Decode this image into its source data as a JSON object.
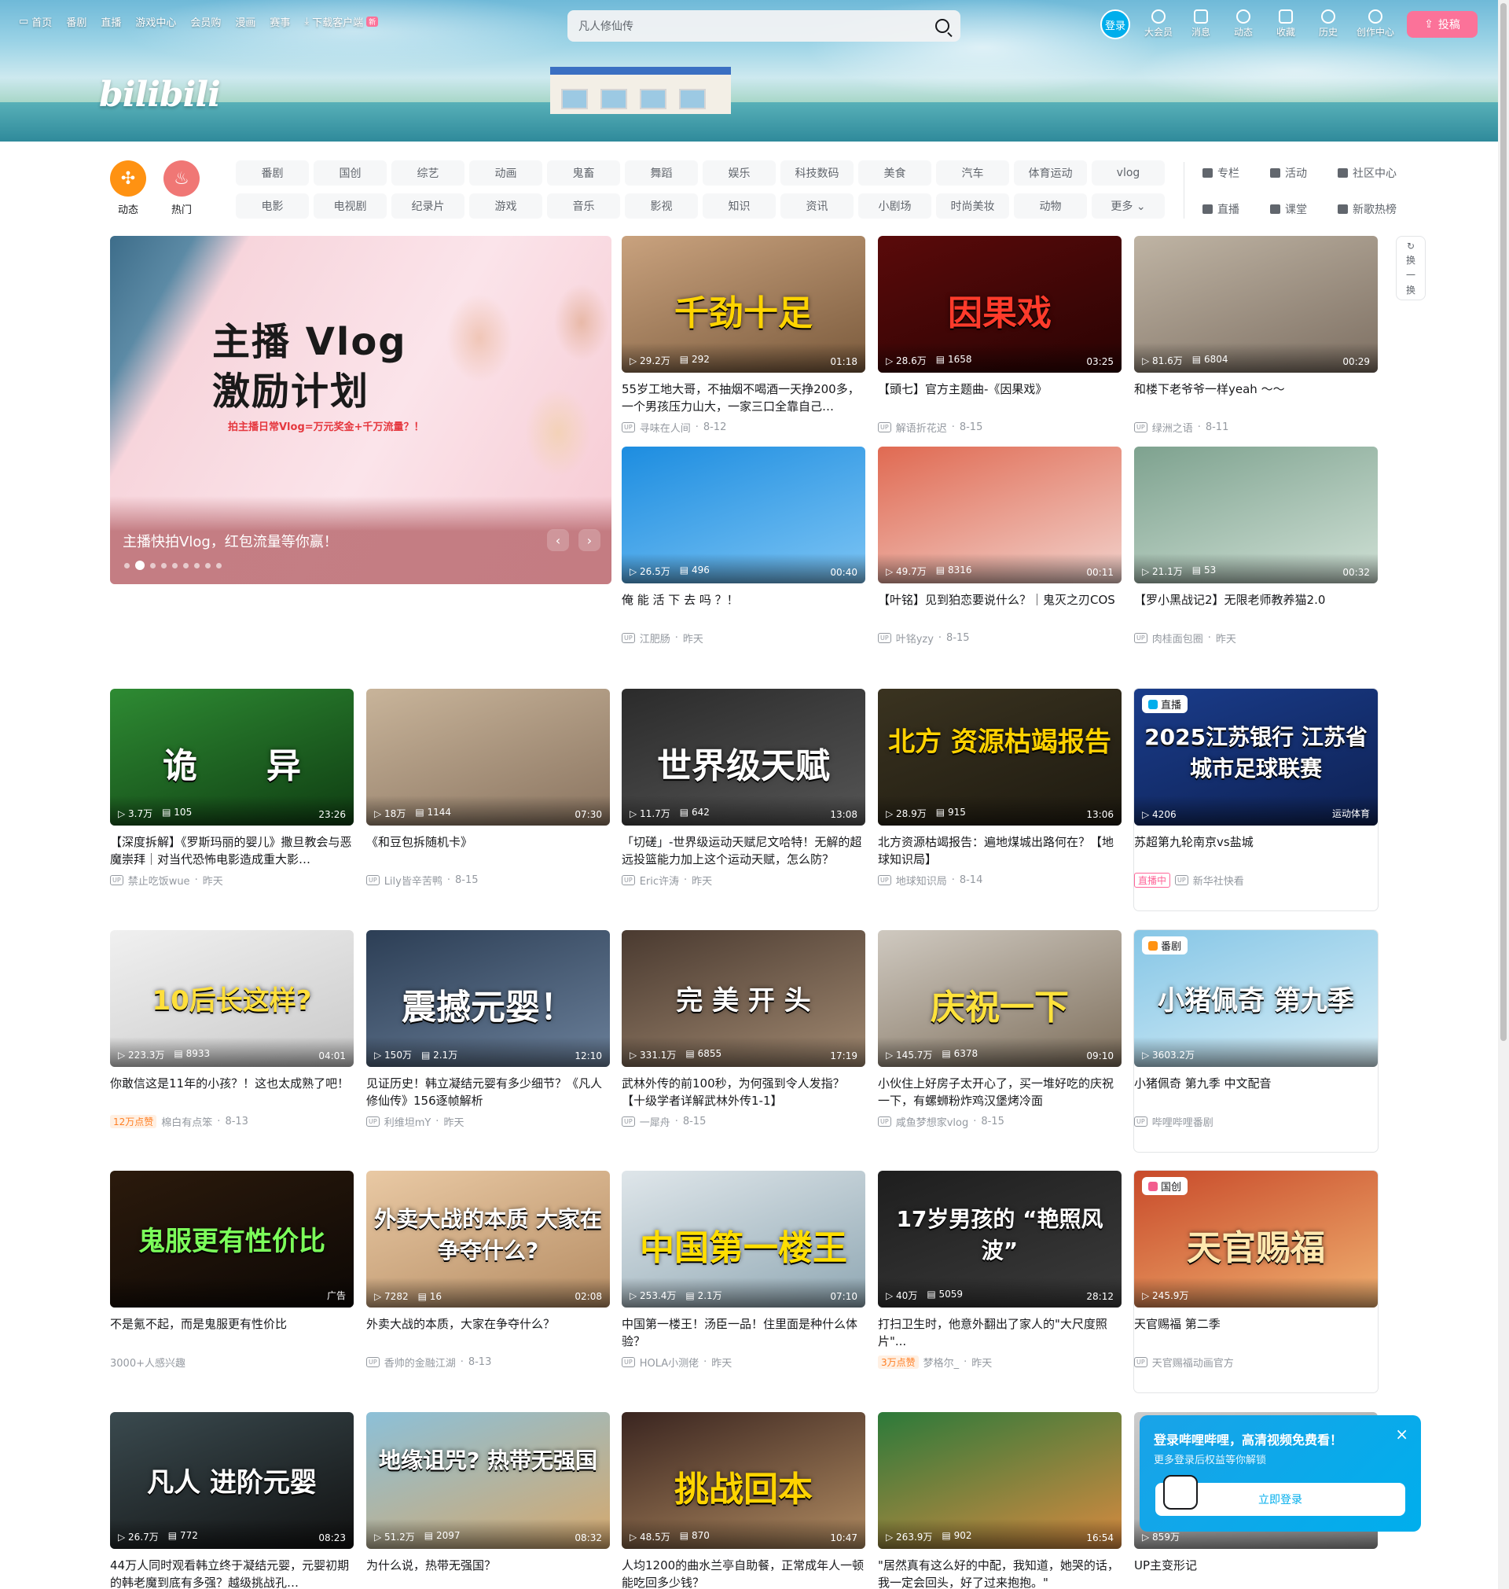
{
  "topnav": [
    "首页",
    "番剧",
    "直播",
    "游戏中心",
    "会员购",
    "漫画",
    "赛事",
    "下载客户端"
  ],
  "newtag": "新",
  "search": {
    "value": "凡人修仙传"
  },
  "logo": "bilibili",
  "rightnav": {
    "login": "登录",
    "items": [
      "大会员",
      "消息",
      "动态",
      "收藏",
      "历史",
      "创作中心"
    ],
    "upload": "投稿"
  },
  "channels": {
    "dynamic": "动态",
    "hot": "热门",
    "row1": [
      "番剧",
      "国创",
      "综艺",
      "动画",
      "鬼畜",
      "舞蹈",
      "娱乐",
      "科技数码",
      "美食",
      "汽车",
      "体育运动",
      "vlog"
    ],
    "row2": [
      "电影",
      "电视剧",
      "纪录片",
      "游戏",
      "音乐",
      "影视",
      "知识",
      "资讯",
      "小剧场",
      "时尚美妆",
      "动物",
      "更多"
    ],
    "right": [
      "专栏",
      "活动",
      "社区中心",
      "直播",
      "课堂",
      "新歌热榜"
    ]
  },
  "banner": {
    "line1": "主播 Vlog",
    "line2": "激励计划",
    "line3": "拍主播日常Vlog=万元奖金+千万流量？！",
    "caption": "主播快拍Vlog，红包流量等你赢！"
  },
  "refresh": [
    "换",
    "一",
    "换"
  ],
  "cards": [
    {
      "views": "29.2万",
      "danmu": "292",
      "dur": "01:18",
      "title": "55岁工地大哥，不抽烟不喝酒一天挣200多，一个男孩压力山大，一家三口全靠自己…",
      "up": "寻味在人间",
      "date": "8-12",
      "big": "千劲十足"
    },
    {
      "views": "28.6万",
      "danmu": "1658",
      "dur": "03:25",
      "title": "【頭七】官方主题曲-《因果戏》",
      "up": "解语折花迟",
      "date": "8-15",
      "big": "因果戏"
    },
    {
      "views": "81.6万",
      "danmu": "6804",
      "dur": "00:29",
      "title": "和楼下老爷爷一样yeah ～～",
      "up": "绿洲之语",
      "date": "8-11",
      "big": ""
    },
    {
      "views": "26.5万",
      "danmu": "496",
      "dur": "00:40",
      "title": "俺 能 活 下 去 吗 ？！",
      "up": "江肥肠",
      "date": "昨天",
      "big": ""
    },
    {
      "views": "49.7万",
      "danmu": "8316",
      "dur": "00:11",
      "title": "【叶铭】见到狛恋要说什么？｜鬼灭之刃COS",
      "up": "叶铭yzy",
      "date": "8-15",
      "big": ""
    },
    {
      "views": "21.1万",
      "danmu": "53",
      "dur": "00:32",
      "title": "【罗小黑战记2】无限老师教养猫2.0",
      "up": "肉桂面包圈",
      "date": "昨天",
      "big": ""
    },
    {
      "views": "3.7万",
      "danmu": "105",
      "dur": "23:26",
      "title": "【深度拆解】《罗斯玛丽的婴儿》撒旦教会与恶魔崇拜｜对当代恐怖电影造成重大影…",
      "up": "禁止吃饭wue",
      "date": "昨天",
      "big": "诡　　异"
    },
    {
      "views": "18万",
      "danmu": "1144",
      "dur": "07:30",
      "title": "《和豆包拆随机卡》",
      "up": "Lily皆辛苦鸭",
      "date": "8-15",
      "big": ""
    },
    {
      "views": "11.7万",
      "danmu": "642",
      "dur": "13:08",
      "title": "「切磋」-世界级运动天赋尼文哈特！无解的超远投篮能力加上这个运动天赋，怎么防？",
      "up": "Eric许涛",
      "date": "昨天",
      "big": "世界级天赋"
    },
    {
      "views": "28.9万",
      "danmu": "915",
      "dur": "13:06",
      "title": "北方资源枯竭报告：遍地煤城出路何在？【地球知识局】",
      "up": "地球知识局",
      "date": "8-14",
      "big": "北方 资源枯竭报告"
    },
    {
      "views": "4206",
      "danmu": "",
      "dur": "运动体育",
      "title": "苏超第九轮南京vs盐城",
      "up": "新华社快看",
      "date": "",
      "big": "2025江苏银行 江苏省城市足球联赛",
      "tag": "直播",
      "live": "直播中"
    },
    {
      "views": "223.3万",
      "danmu": "8933",
      "dur": "04:01",
      "title": "你敢信这是11年的小孩？！这也太成熟了吧！",
      "up": "棉白有点笨",
      "date": "8-13",
      "big": "10后长这样?",
      "hot": "12万点赞"
    },
    {
      "views": "150万",
      "danmu": "2.1万",
      "dur": "12:10",
      "title": "见证历史！韩立凝结元婴有多少细节？《凡人修仙传》156逐帧解析",
      "up": "利维坦mY",
      "date": "昨天",
      "big": "震撼元婴！"
    },
    {
      "views": "331.1万",
      "danmu": "6855",
      "dur": "17:19",
      "title": "武林外传的前100秒，为何强到令人发指？【十级学者详解武林外传1-1】",
      "up": "一犀舟",
      "date": "8-15",
      "big": "完 美 开 头"
    },
    {
      "views": "145.7万",
      "danmu": "6378",
      "dur": "09:10",
      "title": "小伙住上好房子太开心了，买一堆好吃的庆祝一下，有螺蛳粉炸鸡汉堡烤冷面",
      "up": "咸鱼梦想家vlog",
      "date": "8-15",
      "big": "庆祝一下"
    },
    {
      "views": "3603.2万",
      "danmu": "",
      "dur": "",
      "title": "小猪佩奇 第九季 中文配音",
      "up": "哔哩哔哩番剧",
      "date": "",
      "big": "小猪佩奇 第九季",
      "tag": "番剧"
    },
    {
      "views": "",
      "danmu": "",
      "dur": "广告",
      "title": "不是氪不起，而是鬼服更有性价比",
      "up": "3000+人感兴趣",
      "date": "",
      "big": "鬼服更有性价比"
    },
    {
      "views": "7282",
      "danmu": "16",
      "dur": "02:08",
      "title": "外卖大战的本质，大家在争夺什么？",
      "up": "香帅的金融江湖",
      "date": "8-13",
      "big": "外卖大战的本质 大家在争夺什么?"
    },
    {
      "views": "253.4万",
      "danmu": "2.1万",
      "dur": "07:10",
      "title": "中国第一楼王！汤臣一品！住里面是种什么体验？",
      "up": "HOLA小测佬",
      "date": "昨天",
      "big": "中国第一楼王"
    },
    {
      "views": "40万",
      "danmu": "5059",
      "dur": "28:12",
      "title": "打扫卫生时，他意外翻出了家人的\"大尺度照片\"...",
      "up": "梦格尔_",
      "date": "昨天",
      "big": "17岁男孩的 “艳照风波”",
      "hot": "3万点赞"
    },
    {
      "views": "245.9万",
      "danmu": "",
      "dur": "",
      "title": "天官赐福 第二季",
      "up": "天官赐福动画官方",
      "date": "",
      "big": "天官赐福",
      "tag": "国创"
    },
    {
      "views": "26.7万",
      "danmu": "772",
      "dur": "08:23",
      "title": "44万人同时观看韩立终于凝结元婴，元婴初期的韩老魔到底有多强？越级挑战孔…",
      "up": "",
      "date": "",
      "big": "凡人 进阶元婴"
    },
    {
      "views": "51.2万",
      "danmu": "2097",
      "dur": "08:32",
      "title": "为什么说，热带无强国？",
      "up": "",
      "date": "",
      "big": "地缘诅咒? 热带无强国"
    },
    {
      "views": "48.5万",
      "danmu": "870",
      "dur": "10:47",
      "title": "人均1200的曲水兰亭自助餐，正常成年人一顿能吃回多少钱？",
      "up": "",
      "date": "",
      "big": "挑战回本"
    },
    {
      "views": "263.9万",
      "danmu": "902",
      "dur": "16:54",
      "title": "\"居然真有这么好的中配，我知道，她哭的话，我一定会回头，好了过来抱抱。\"",
      "up": "",
      "date": "",
      "big": ""
    },
    {
      "views": "859万",
      "danmu": "",
      "dur": "",
      "title": "UP主变形记",
      "up": "",
      "date": "",
      "big": ""
    }
  ],
  "popup": {
    "title": "登录哔哩哔哩，高清视频免费看！",
    "sub": "更多登录后权益等你解锁",
    "btn": "立即登录"
  },
  "colors": {
    "accent": "#fb7299",
    "blue": "#00aeec",
    "orange": "#ff7f24"
  }
}
